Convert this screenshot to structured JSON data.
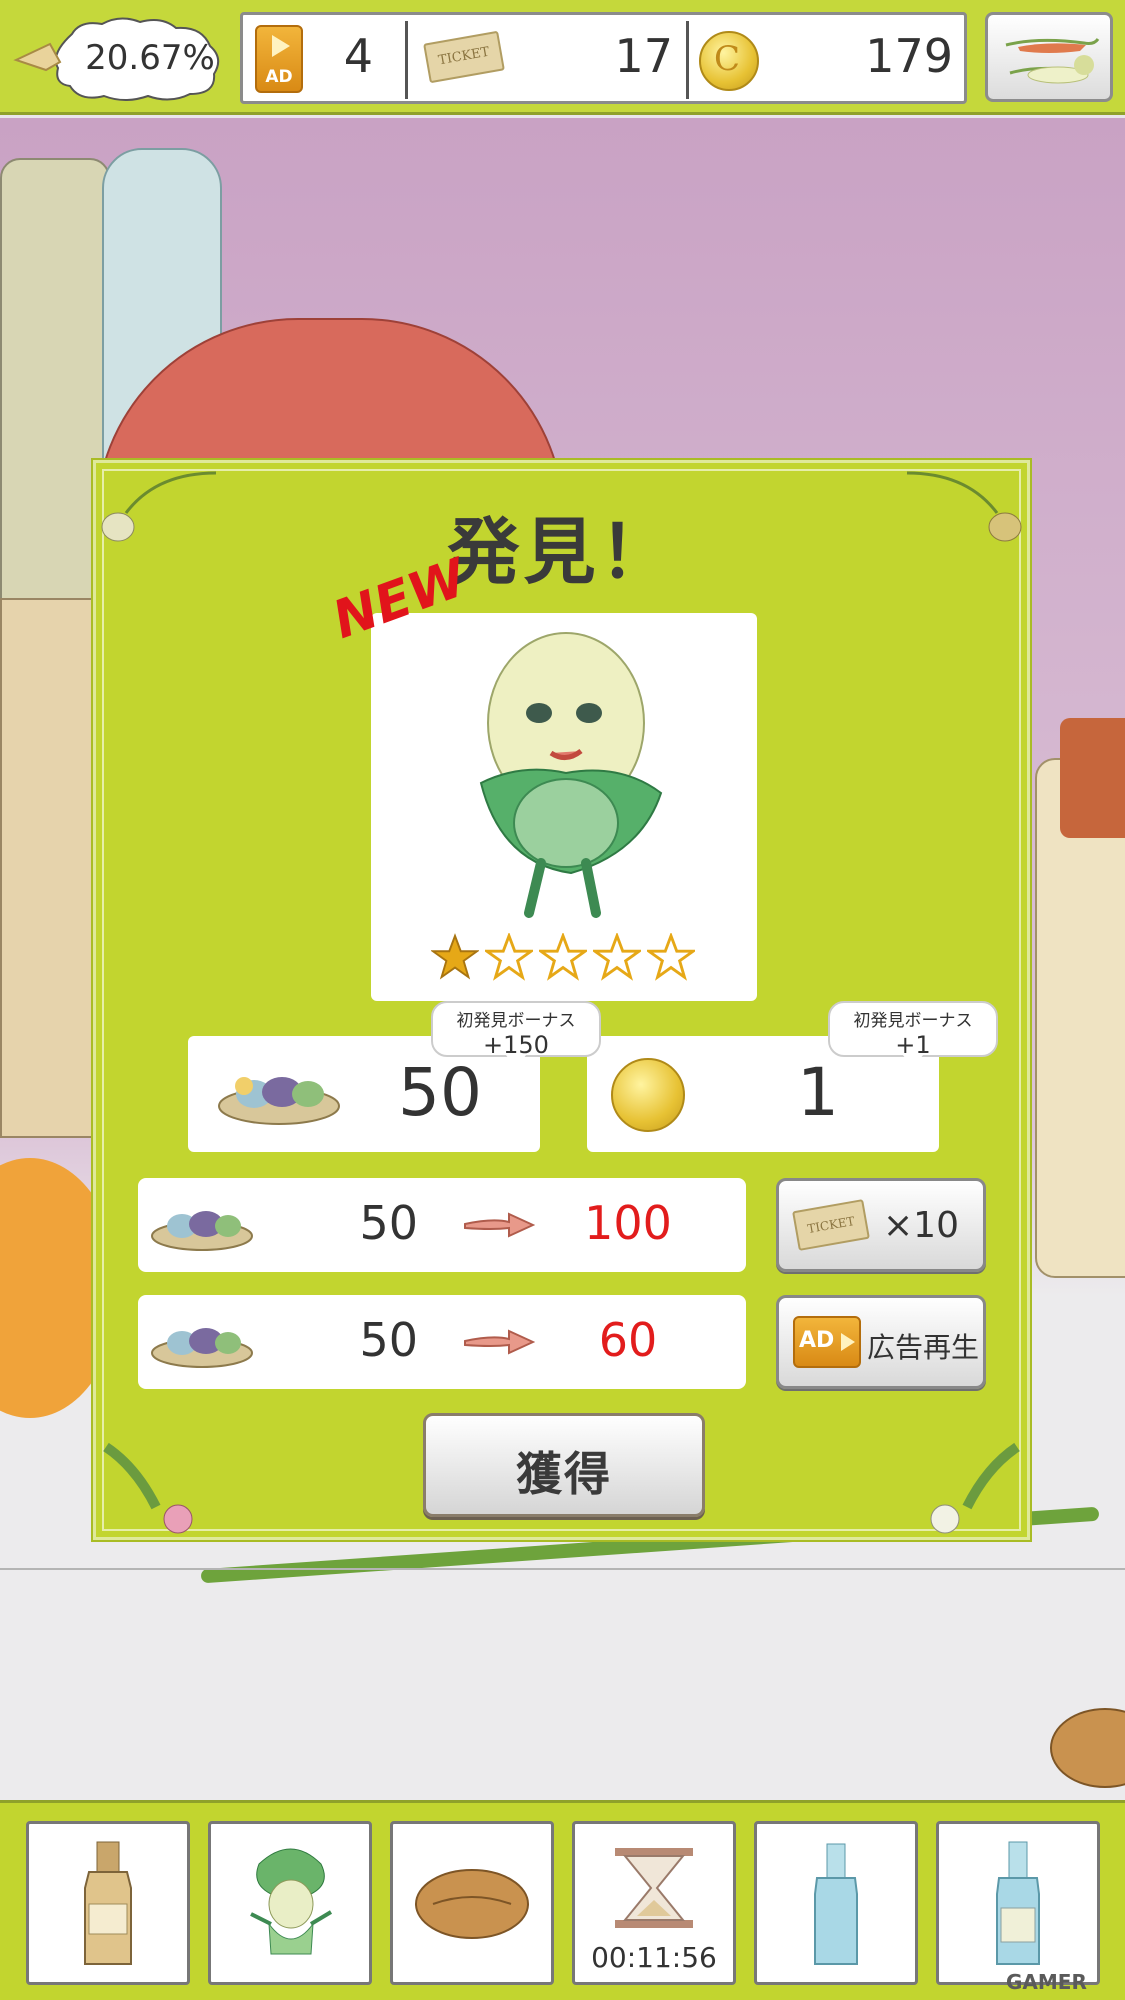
{
  "header": {
    "progress": "20.67%",
    "ad_count": "4",
    "ad_badge": "AD",
    "ticket_label": "TICKET",
    "ticket_count": "17",
    "coin_count": "179"
  },
  "dialog": {
    "title": "発見！",
    "new_label": "NEW",
    "rarity_stars": 1,
    "rarity_max": 5,
    "bonus_left": {
      "label": "初発見ボーナス",
      "value": "+150"
    },
    "bonus_right": {
      "label": "初発見ボーナス",
      "value": "+1"
    },
    "reward_basket": "50",
    "reward_coin": "1",
    "trade_ticket": {
      "from": "50",
      "to": "100",
      "button_multiplier": "×10",
      "ticket_label": "TICKET"
    },
    "trade_ad": {
      "from": "50",
      "to": "60",
      "button_ad": "AD",
      "button_label": "広告再生"
    },
    "acquire_button": "獲得"
  },
  "bottom_bar": {
    "slots": [
      {
        "icon": "bottle-icon"
      },
      {
        "icon": "vegetable-fairy-icon"
      },
      {
        "icon": "walnut-icon"
      },
      {
        "icon": "hourglass-icon",
        "timer": "00:11:56"
      },
      {
        "icon": "blue-bottle-icon"
      },
      {
        "icon": "labeled-bottle-icon"
      }
    ]
  },
  "watermark": "GAMER",
  "colors": {
    "frame_green": "#c2d52f",
    "accent_red": "#e21c1c",
    "star_gold": "#e6a817"
  }
}
